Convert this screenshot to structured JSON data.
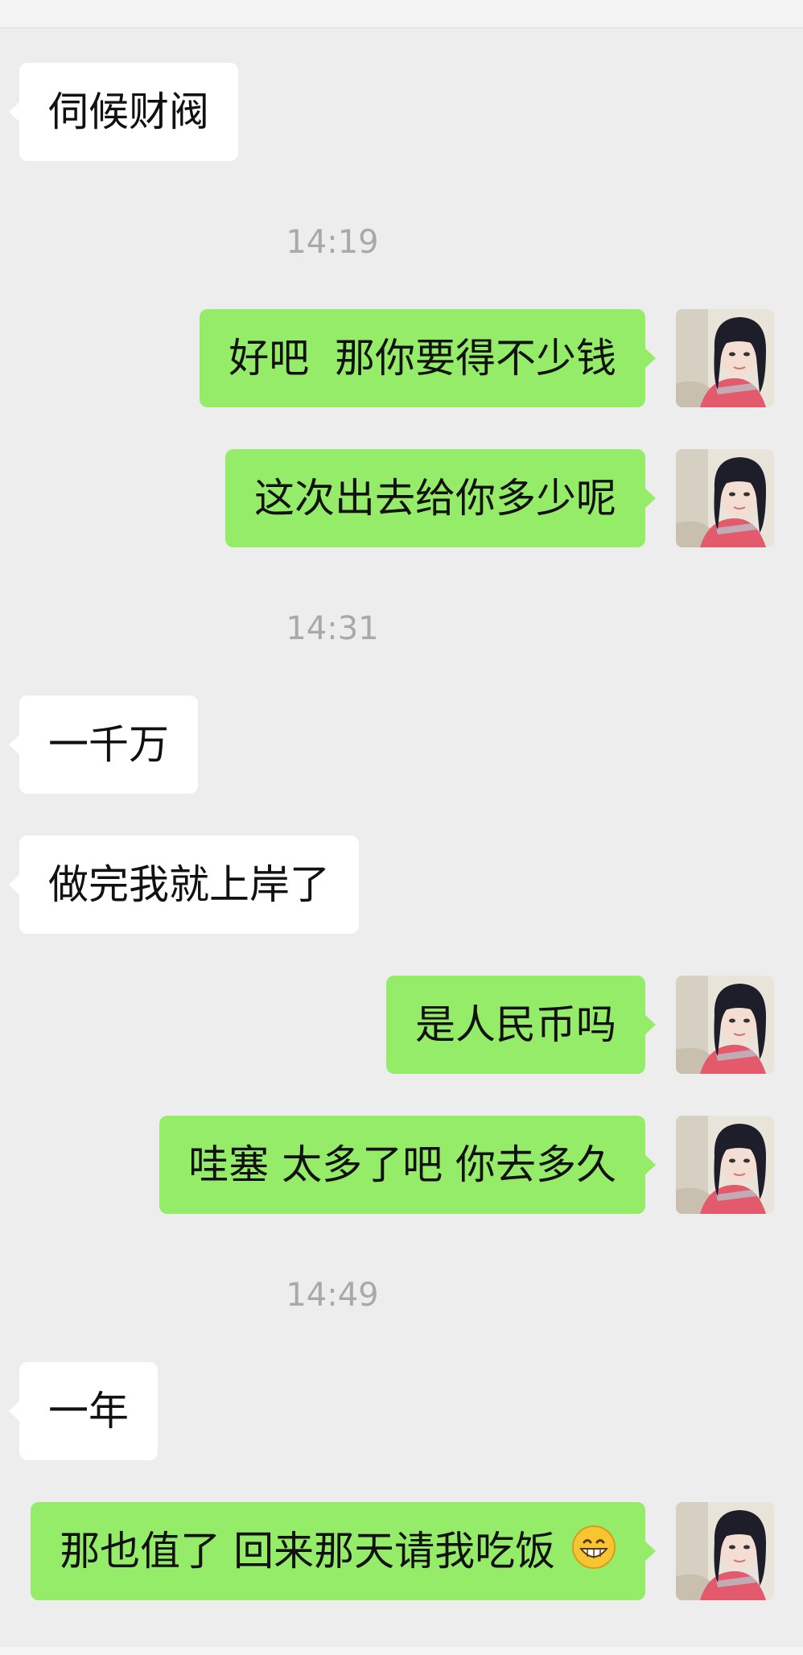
{
  "messages": [
    {
      "id": "m1",
      "side": "in",
      "text": "伺候财阀"
    },
    {
      "id": "t1",
      "type": "time",
      "text": "14:19"
    },
    {
      "id": "m2",
      "side": "out",
      "text": "好吧  那你要得不少钱"
    },
    {
      "id": "m3",
      "side": "out",
      "text": "这次出去给你多少呢"
    },
    {
      "id": "t2",
      "type": "time",
      "text": "14:31"
    },
    {
      "id": "m4",
      "side": "in",
      "text": "一千万"
    },
    {
      "id": "m5",
      "side": "in",
      "text": "做完我就上岸了"
    },
    {
      "id": "m6",
      "side": "out",
      "text": "是人民币吗"
    },
    {
      "id": "m7",
      "side": "out",
      "text": "哇塞 太多了吧 你去多久"
    },
    {
      "id": "t3",
      "type": "time",
      "text": "14:49"
    },
    {
      "id": "m8",
      "side": "in",
      "text": "一年"
    },
    {
      "id": "m9",
      "side": "out",
      "text": "那也值了 回来那天请我吃饭",
      "emoji": "grinning-face-emoji"
    }
  ],
  "colors": {
    "background": "#ededed",
    "incoming_bubble": "#ffffff",
    "outgoing_bubble": "#95ec69",
    "timestamp": "#a9a9a9"
  },
  "avatar_icon": "user-avatar"
}
